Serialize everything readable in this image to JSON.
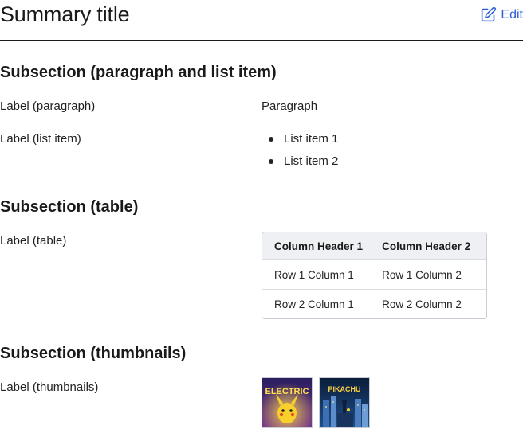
{
  "summary": {
    "title": "Summary title",
    "edit_label": "Edit"
  },
  "sections": {
    "paragraph_list": {
      "heading": "Subsection (paragraph and list item)",
      "paragraph_label": "Label (paragraph)",
      "paragraph_value": "Paragraph",
      "list_label": "Label (list item)",
      "list_items": [
        "List item 1",
        "List item 2"
      ]
    },
    "table": {
      "heading": "Subsection (table)",
      "label": "Label (table)",
      "headers": [
        "Column Header 1",
        "Column Header 2"
      ],
      "rows": [
        [
          "Row 1 Column 1",
          "Row 1 Column 2"
        ],
        [
          "Row 2 Column 1",
          "Row 2 Column 2"
        ]
      ]
    },
    "thumbnails": {
      "heading": "Subsection (thumbnails)",
      "label": "Label (thumbnails)",
      "images": [
        {
          "icon": "poster-thumbnail-icon",
          "poster_text": "ELECTRIC"
        },
        {
          "icon": "poster-thumbnail-icon",
          "poster_text": "PIKACHU"
        }
      ]
    }
  },
  "colors": {
    "accent": "#2b5fd9",
    "divider": "#d9dce1",
    "header_rule": "#1a1a1a",
    "table_header_bg": "#eef0f3"
  }
}
